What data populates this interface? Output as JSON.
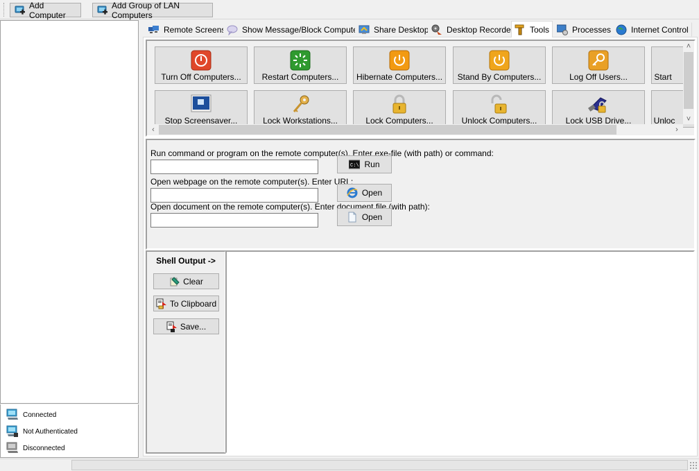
{
  "toolbar": {
    "add_computer": "Add Computer",
    "add_group": "Add Group of LAN Computers"
  },
  "legend": {
    "items": [
      {
        "label": "Connected",
        "icon": "computer-connected-icon"
      },
      {
        "label": "Not Authenticated",
        "icon": "computer-not-authenticated-icon"
      },
      {
        "label": "Disconnected",
        "icon": "computer-disconnected-icon"
      }
    ]
  },
  "tabs": [
    {
      "label": "Remote Screens",
      "icon": "monitors-icon",
      "active": false
    },
    {
      "label": "Show Message/Block Computers",
      "icon": "speech-bubble-icon",
      "active": false
    },
    {
      "label": "Share Desktop",
      "icon": "share-desktop-icon",
      "active": false
    },
    {
      "label": "Desktop Recorder",
      "icon": "film-recorder-icon",
      "active": false
    },
    {
      "label": "Tools",
      "icon": "drill-tool-icon",
      "active": true
    },
    {
      "label": "Processes",
      "icon": "processes-icon",
      "active": false
    },
    {
      "label": "Internet Control",
      "icon": "globe-icon",
      "active": false
    }
  ],
  "tools": {
    "row1": [
      {
        "label": "Turn Off Computers...",
        "icon": "power-off-icon",
        "color": "#e0472a"
      },
      {
        "label": "Restart Computers...",
        "icon": "restart-icon",
        "color": "#2f9a2f"
      },
      {
        "label": "Hibernate Computers...",
        "icon": "hibernate-icon",
        "color": "#f29a12"
      },
      {
        "label": "Stand By Computers...",
        "icon": "standby-icon",
        "color": "#efa51c"
      },
      {
        "label": "Log Off Users...",
        "icon": "log-off-key-icon",
        "color": "#e9a026"
      },
      {
        "label": "Start",
        "icon": "start-icon",
        "color": "#e1e1e1"
      }
    ],
    "row2": [
      {
        "label": "Stop Screensaver...",
        "icon": "screensaver-icon",
        "color": "#1d4f9c"
      },
      {
        "label": "Lock Workstations...",
        "icon": "key-icon",
        "color": "#d9a23a"
      },
      {
        "label": "Lock Computers...",
        "icon": "padlock-icon",
        "color": "#e8b530"
      },
      {
        "label": "Unlock Computers...",
        "icon": "unlocked-padlock-icon",
        "color": "#e8b530"
      },
      {
        "label": "Lock USB Drive...",
        "icon": "usb-lock-icon",
        "color": "#2a2f8c"
      },
      {
        "label": "Unloc",
        "icon": "unlock-icon",
        "color": "#e1e1e1"
      }
    ]
  },
  "commands": {
    "run_label": "Run command or program on the remote computer(s). Enter exe-file (with path) or command:",
    "run_value": "",
    "run_button": "Run",
    "url_label": "Open webpage on the remote computer(s). Enter URL:",
    "url_value": "",
    "url_button": "Open",
    "doc_label": "Open document on the remote computer(s). Enter document file (with path):",
    "doc_value": "",
    "doc_button": "Open"
  },
  "shell": {
    "title": "Shell Output ->",
    "clear": "Clear",
    "clipboard": "To Clipboard",
    "save": "Save..."
  },
  "status": {
    "text": ""
  }
}
